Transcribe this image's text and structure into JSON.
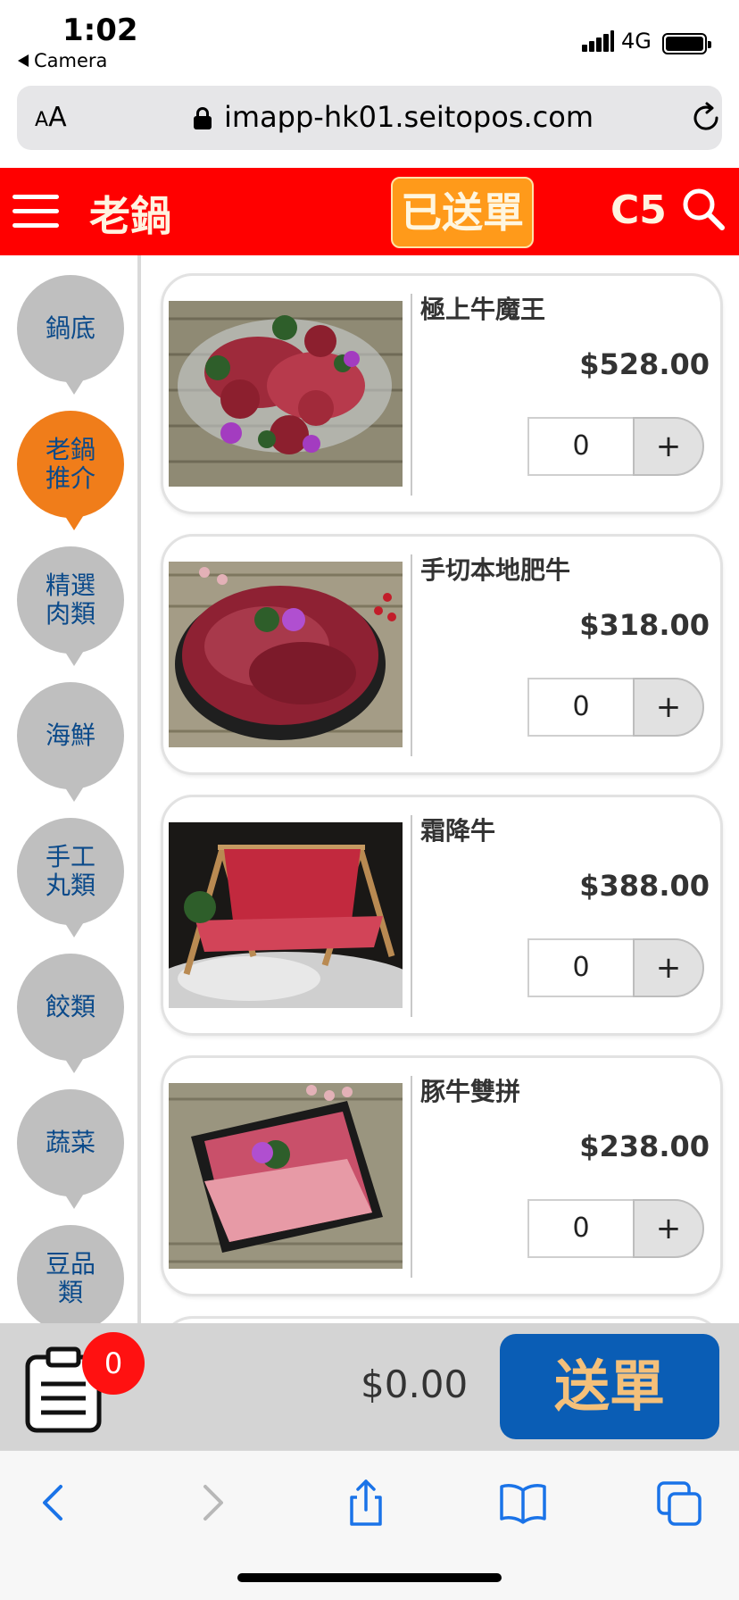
{
  "status_bar": {
    "time": "1:02",
    "back_app": "Camera",
    "network": "4G"
  },
  "browser": {
    "text_size_label": "AA",
    "url": "imapp-hk01.seitopos.com"
  },
  "header": {
    "brand": "老鍋",
    "sent_label": "已送單",
    "table_no": "C5"
  },
  "categories": [
    {
      "label": "鍋底",
      "active": false
    },
    {
      "label": "老鍋推介",
      "active": true
    },
    {
      "label": "精選肉類",
      "active": false
    },
    {
      "label": "海鮮",
      "active": false
    },
    {
      "label": "手工丸類",
      "active": false
    },
    {
      "label": "餃類",
      "active": false
    },
    {
      "label": "蔬菜",
      "active": false
    },
    {
      "label": "豆品類",
      "active": false
    }
  ],
  "products": [
    {
      "name": "極上牛魔王",
      "price": "$528.00",
      "qty": "0",
      "plus": "+"
    },
    {
      "name": "手切本地肥牛",
      "price": "$318.00",
      "qty": "0",
      "plus": "+"
    },
    {
      "name": "霜降牛",
      "price": "$388.00",
      "qty": "0",
      "plus": "+"
    },
    {
      "name": "豚牛雙拼",
      "price": "$238.00",
      "qty": "0",
      "plus": "+"
    }
  ],
  "cart": {
    "count": "0",
    "total": "$0.00",
    "submit_label": "送單"
  },
  "colors": {
    "header_red": "#ff0000",
    "active_category": "#f07d1a",
    "submit_blue": "#0a5db5",
    "badge_red": "#ff1111"
  }
}
